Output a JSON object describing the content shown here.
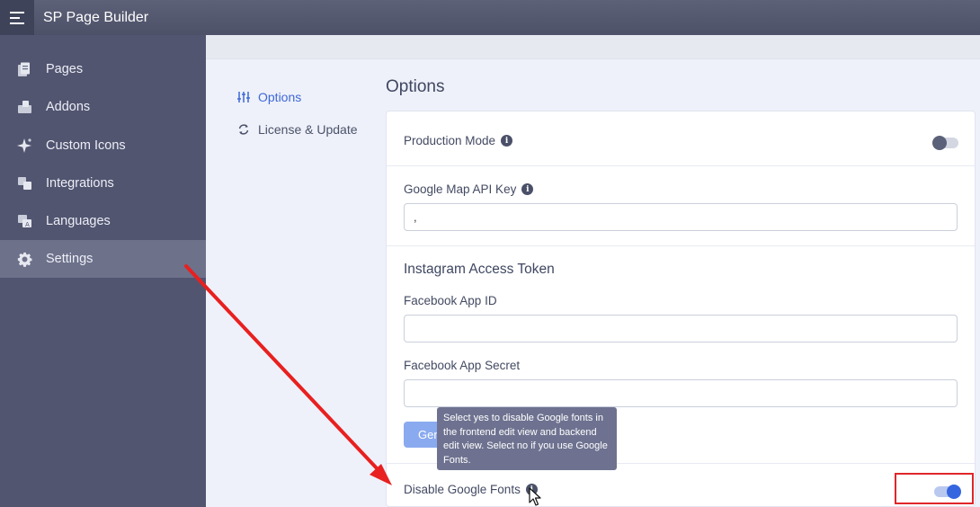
{
  "app": {
    "title": "SP Page Builder"
  },
  "sidebar": {
    "items": [
      {
        "label": "Pages",
        "icon": "pages-icon"
      },
      {
        "label": "Addons",
        "icon": "addons-icon"
      },
      {
        "label": "Custom Icons",
        "icon": "sparkle-icon"
      },
      {
        "label": "Integrations",
        "icon": "integrations-icon"
      },
      {
        "label": "Languages",
        "icon": "languages-icon"
      },
      {
        "label": "Settings",
        "icon": "gear-icon",
        "active": true
      }
    ]
  },
  "settings_nav": {
    "items": [
      {
        "label": "Options",
        "icon": "sliders-icon",
        "active": true
      },
      {
        "label": "License & Update",
        "icon": "refresh-icon"
      }
    ]
  },
  "options": {
    "title": "Options",
    "production_mode": {
      "label": "Production Mode",
      "enabled": false
    },
    "google_map_api_key": {
      "label": "Google Map API Key",
      "value": ","
    },
    "instagram": {
      "section_title": "Instagram Access Token",
      "facebook_app_id": {
        "label": "Facebook App ID",
        "value": ""
      },
      "facebook_app_secret": {
        "label": "Facebook App Secret",
        "value": ""
      },
      "generate_button_label": "Gen"
    },
    "disable_google_fonts": {
      "label": "Disable Google Fonts",
      "enabled": true,
      "tooltip": "Select yes to disable Google fonts in the frontend edit view and backend edit view. Select no if you use Google Fonts."
    }
  },
  "colors": {
    "accent": "#3566e0",
    "sidebar_bg": "#515570",
    "annotation_red": "#e0262a"
  }
}
